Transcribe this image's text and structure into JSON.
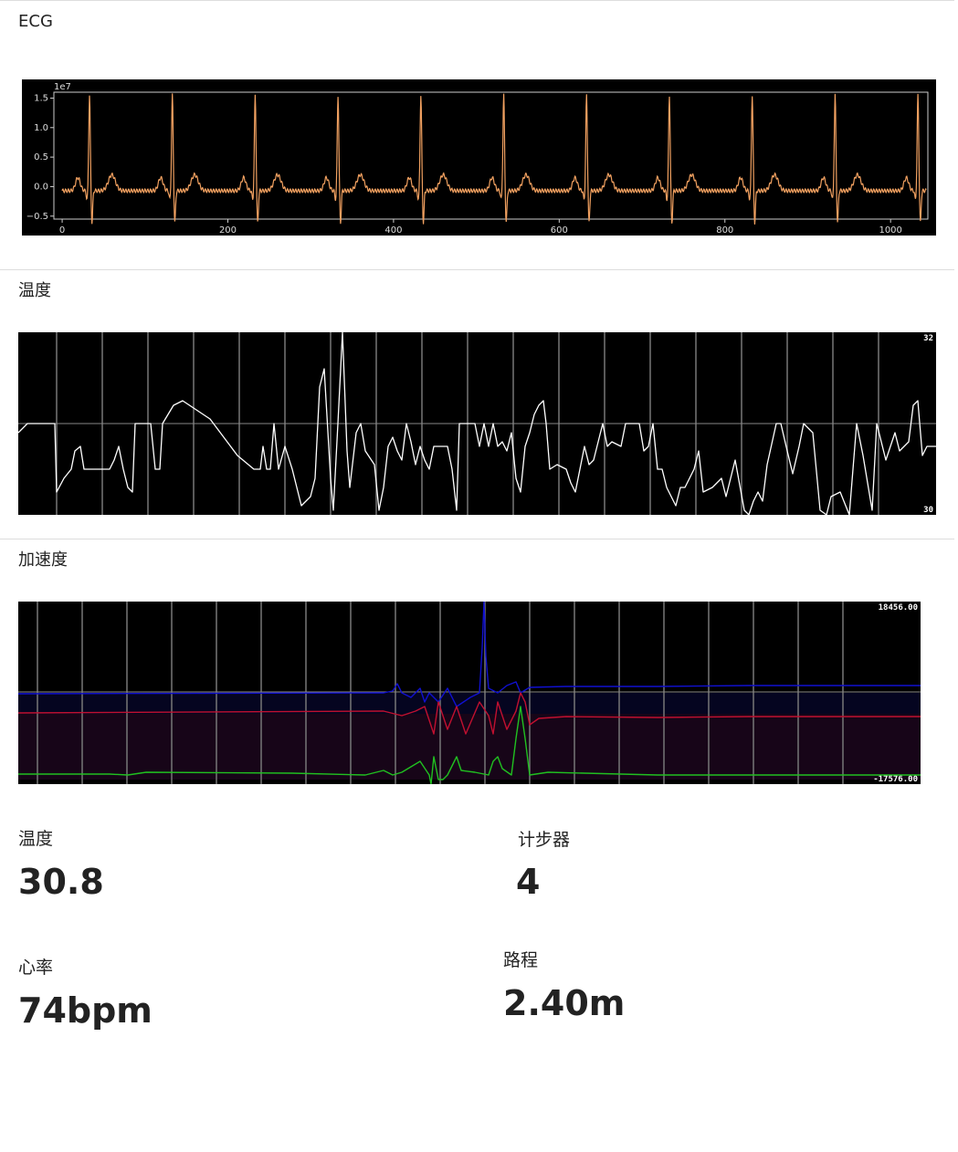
{
  "sections": {
    "ecg_title": "ECG",
    "temp_title": "温度",
    "accel_title": "加速度"
  },
  "stats": {
    "temp_label": "温度",
    "temp_value": "30.8",
    "steps_label": "计步器",
    "steps_value": "4",
    "hr_label": "心率",
    "hr_value": "74bpm",
    "distance_label": "路程",
    "distance_value": "2.40m"
  },
  "chart_data": [
    {
      "type": "line",
      "x_ticks": [
        "0",
        "200",
        "400",
        "600",
        "800",
        "1000"
      ],
      "y_ticks": [
        "1.5",
        "1.0",
        "0.5",
        "0.0",
        "−0.5"
      ],
      "y_scale_label": "1e7",
      "xlim": [
        -10,
        1045
      ],
      "ylim": [
        -0.55,
        1.6
      ],
      "beat_positions": [
        33,
        133,
        233,
        333,
        433,
        533,
        633,
        733,
        833,
        933,
        1033
      ],
      "colors": {
        "line": "#f0a060",
        "background": "#000000"
      }
    },
    {
      "type": "line",
      "y_max_label": "32",
      "y_min_label": "30",
      "colors": {
        "line": "#ffffff",
        "background": "#000000",
        "grid": "#888888"
      }
    },
    {
      "type": "line",
      "y_max_label": "18456.00",
      "y_min_label": "-17576.00",
      "series": [
        {
          "color": "#1010d0"
        },
        {
          "color": "#c01030"
        },
        {
          "color": "#20c020"
        }
      ],
      "colors": {
        "background": "#000000",
        "grid": "#888888"
      }
    }
  ]
}
